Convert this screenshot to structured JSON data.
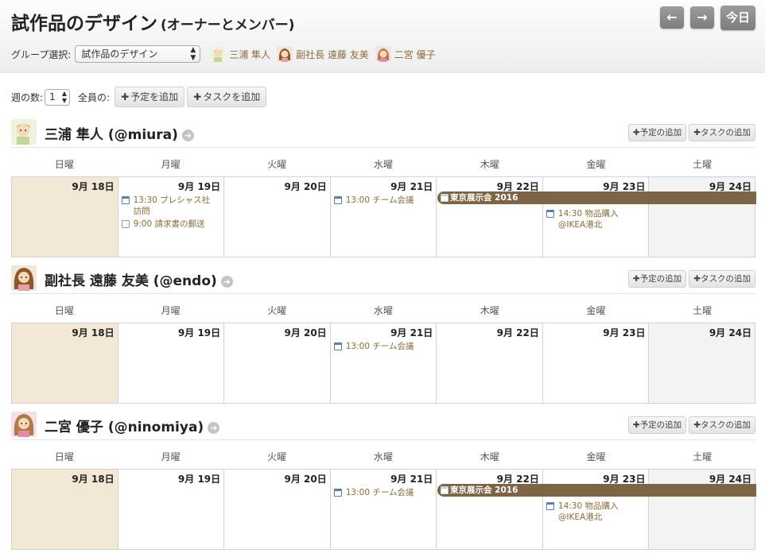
{
  "header": {
    "title": "試作品のデザイン",
    "subtitle": "(オーナーとメンバー)",
    "prev_label": "←",
    "next_label": "→",
    "today_label": "今日",
    "group_select_label": "グループ選択:",
    "group_select_value": "試作品のデザイン",
    "members": [
      {
        "name": "三浦 隼人"
      },
      {
        "name": "副社長 遠藤 友美"
      },
      {
        "name": "二宮 優子"
      }
    ]
  },
  "controls": {
    "weeks_label": "週の数:",
    "weeks_value": "1",
    "all_label": "全員の:",
    "add_event": "予定を追加",
    "add_task": "タスクを追加"
  },
  "section_buttons": {
    "add_event": "予定の追加",
    "add_task": "タスクの追加"
  },
  "weekdays": [
    "日曜",
    "月曜",
    "火曜",
    "水曜",
    "木曜",
    "金曜",
    "土曜"
  ],
  "dates": [
    "9月 18日",
    "9月 19日",
    "9月 20日",
    "9月 21日",
    "9月 22日",
    "9月 23日",
    "9月 24日"
  ],
  "people": [
    {
      "name": "三浦 隼人 (@miura)",
      "events": {
        "mon_1": "13:30 プレシャス社 訪問",
        "mon_2": "9:00 請求書の郵送",
        "wed_1": "13:00 チーム会議",
        "banner": "東京展示会 2016",
        "fri_1": "14:30 物品購入@IKEA港北"
      }
    },
    {
      "name": "副社長 遠藤 友美 (@endo)",
      "events": {
        "wed_1": "13:00 チーム会議"
      }
    },
    {
      "name": "二宮 優子 (@ninomiya)",
      "events": {
        "wed_1": "13:00 チーム会議",
        "banner": "東京展示会 2016",
        "fri_1": "14:30 物品購入@IKEA港北"
      }
    }
  ],
  "colors": {
    "banner": "#7d6444",
    "event_text": "#8a6d3b",
    "today_bg": "#f3e7d6",
    "weekend_bg": "#f3f3f3",
    "nav_btn": "#8c8c8c"
  }
}
